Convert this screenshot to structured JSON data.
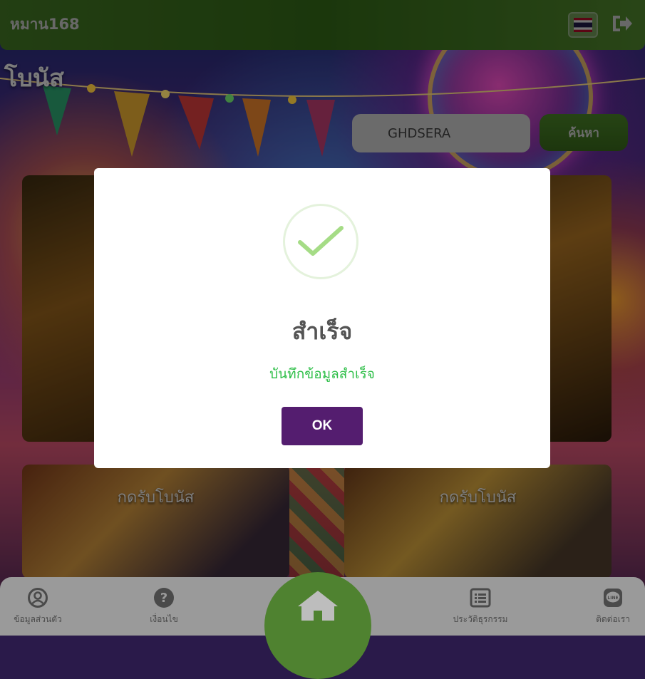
{
  "header": {
    "brand": "หมาน168",
    "language_icon": "thai-flag-icon",
    "logout_icon": "logout-icon"
  },
  "page": {
    "title": "โบนัส"
  },
  "search": {
    "value": "GHDSERA",
    "button_label": "ค้นหา"
  },
  "promo_cards": [
    {
      "label": "กดรับโบนัส"
    },
    {
      "label": "กดรับโบนัส"
    }
  ],
  "bottom_nav": {
    "items": [
      {
        "label": "ข้อมูลส่วนตัว",
        "icon": "user-circle-icon"
      },
      {
        "label": "เงื่อนไข",
        "icon": "question-circle-icon"
      },
      {
        "label": "",
        "icon": "home-icon"
      },
      {
        "label": "ประวัติธุรกรรม",
        "icon": "list-icon"
      },
      {
        "label": "ติดต่อเรา",
        "icon": "line-chat-icon"
      }
    ]
  },
  "modal": {
    "icon": "success-check-icon",
    "title": "สำเร็จ",
    "message": "บันทึกข้อมูลสำเร็จ",
    "ok_label": "OK"
  },
  "colors": {
    "header_green": "#4e8a2a",
    "ok_button": "#541d6f",
    "success_text": "#2fbf49",
    "check_green": "#a5dc86"
  }
}
